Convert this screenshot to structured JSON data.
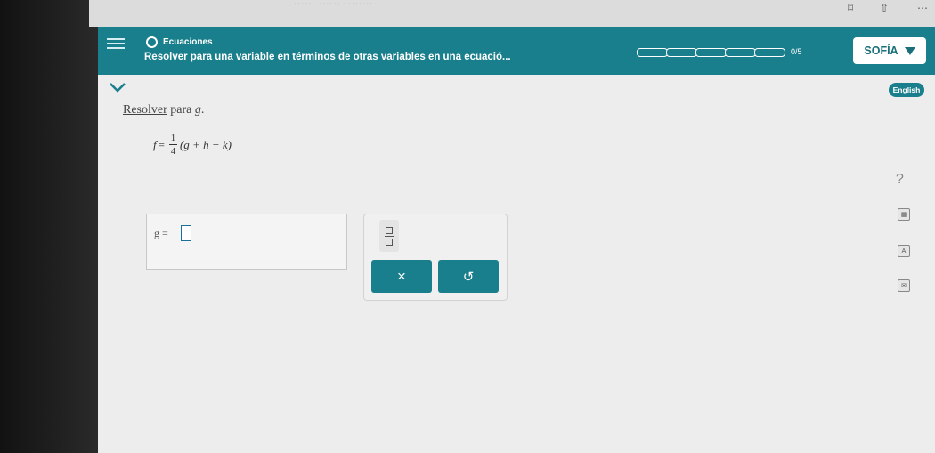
{
  "browser": {
    "url_fragment": "...... ...... ........"
  },
  "header": {
    "topic": "Ecuaciones",
    "title": "Resolver para una variable en términos de otras variables en una ecuació...",
    "progress": {
      "completed": 0,
      "total": 5,
      "text": "0/5"
    },
    "user_name": "SOFÍA",
    "accent_color": "#1a7f8c"
  },
  "toolbar": {
    "language_label": "English"
  },
  "problem": {
    "instruction_link": "Resolver",
    "instruction_text": " para ",
    "variable": "g",
    "period": ".",
    "equation": {
      "lhs": "f",
      "equals": "=",
      "frac_num": "1",
      "frac_den": "4",
      "rhs": "(g + h − k)"
    }
  },
  "answer": {
    "label": "g ="
  },
  "keypad": {
    "clear_label": "×",
    "undo_label": "↺"
  },
  "side_tools": {
    "help_label": "?",
    "icons": [
      "calculator-icon",
      "dictionary-icon",
      "message-icon"
    ]
  }
}
